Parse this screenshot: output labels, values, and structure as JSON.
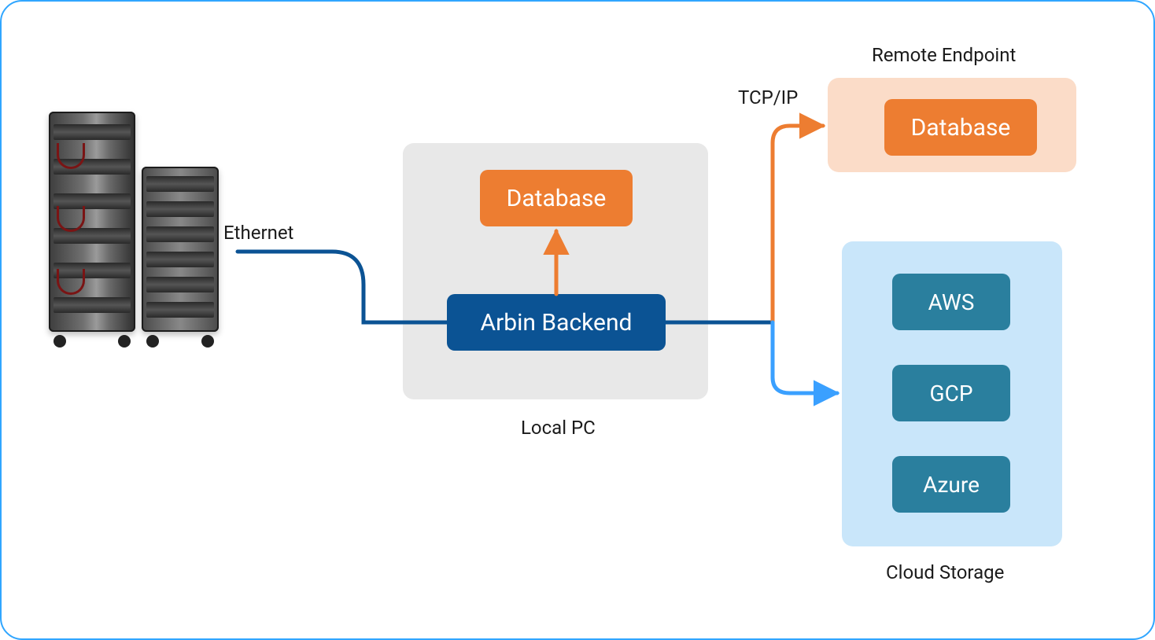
{
  "connections": {
    "ethernet": "Ethernet",
    "tcpip": "TCP/IP"
  },
  "local_pc": {
    "caption": "Local PC",
    "database": "Database",
    "backend": "Arbin Backend"
  },
  "remote_endpoint": {
    "caption": "Remote Endpoint",
    "database": "Database"
  },
  "cloud_storage": {
    "caption": "Cloud Storage",
    "providers": {
      "aws": "AWS",
      "gcp": "GCP",
      "azure": "Azure"
    }
  },
  "colors": {
    "orange": "#ed7d31",
    "dark_blue": "#0b5394",
    "teal": "#2a7f9e",
    "light_blue_arrow": "#3aa0ff"
  }
}
